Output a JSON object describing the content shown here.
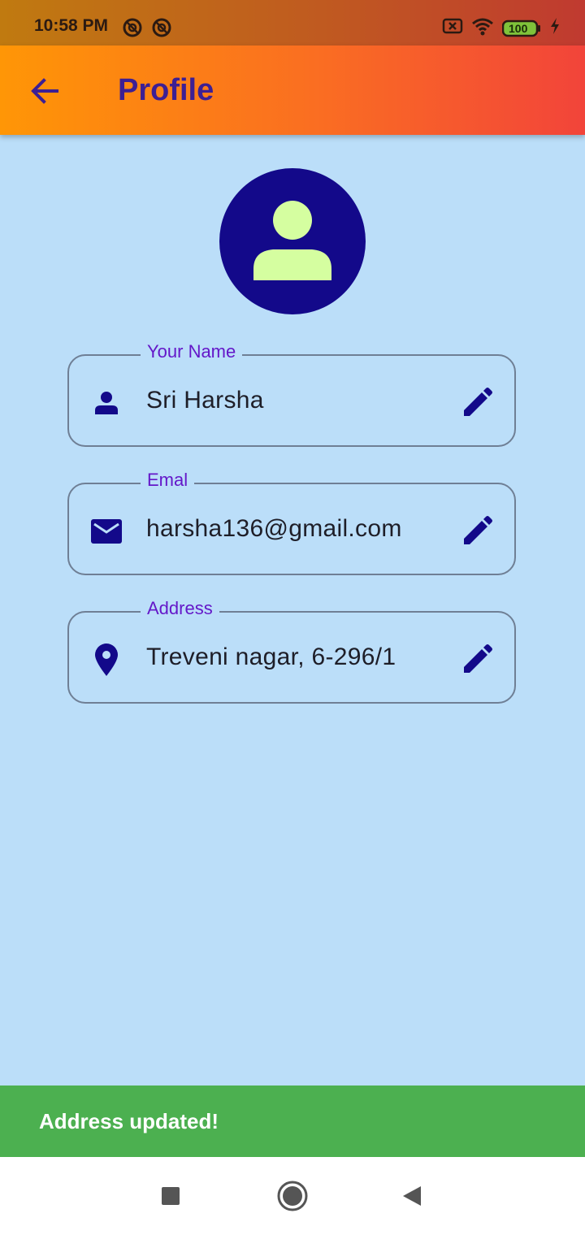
{
  "status_bar": {
    "time": "10:58 PM",
    "battery": "100",
    "icons": [
      "sync-icon",
      "sync-icon",
      "sim-off-icon",
      "wifi-icon",
      "battery-icon",
      "charging-icon"
    ]
  },
  "app_bar": {
    "title": "Profile",
    "back_icon": "arrow-back-icon"
  },
  "profile": {
    "avatar_icon": "person-icon",
    "fields": [
      {
        "label": "Your Name",
        "value": "Sri Harsha",
        "icon": "person-icon",
        "action_icon": "edit-icon"
      },
      {
        "label": "Emal",
        "value": "harsha136@gmail.com",
        "icon": "mail-icon",
        "action_icon": "edit-icon"
      },
      {
        "label": "Address",
        "value": "Treveni nagar, 6-296/1",
        "icon": "location-pin-icon",
        "action_icon": "edit-icon"
      }
    ]
  },
  "snackbar": {
    "message": "Address updated!"
  },
  "nav_bar": {
    "buttons": [
      "recents-icon",
      "home-icon",
      "back-icon"
    ]
  },
  "colors": {
    "background": "#bbdef9",
    "accent": "#13098a",
    "title": "#3d1f93",
    "label": "#6418c9",
    "snackbar": "#4cb050",
    "avatar_figure": "#d5fea0"
  }
}
